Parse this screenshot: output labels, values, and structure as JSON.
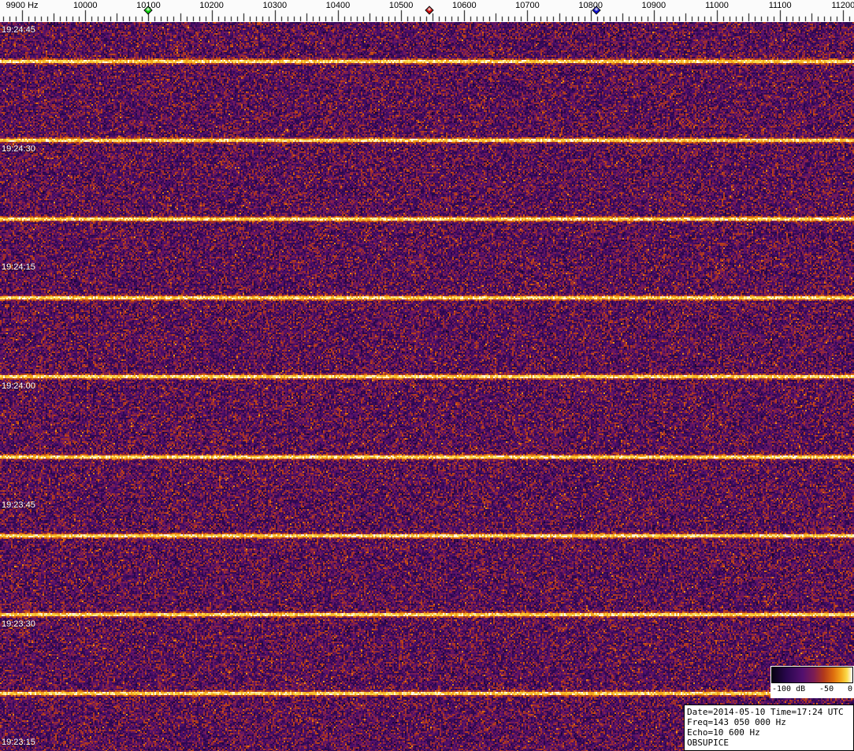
{
  "chart_data": {
    "type": "heatmap",
    "subtype": "radio-spectrogram-waterfall",
    "x_axis": {
      "unit": "Hz",
      "start": 9865,
      "end": 11217,
      "tick_step": 100,
      "minor_tick_step": 10,
      "tick_values": [
        9900,
        10000,
        10100,
        10200,
        10300,
        10400,
        10500,
        10600,
        10700,
        10800,
        10900,
        11000,
        11100,
        11200
      ],
      "tick_labels": [
        "9900 Hz",
        "10000",
        "10100",
        "10200",
        "10300",
        "10400",
        "10500",
        "10600",
        "10700",
        "10800",
        "10900",
        "11000",
        "11100",
        "11200"
      ]
    },
    "y_axis": {
      "unit": "time UTC",
      "direction": "newest-on-top",
      "tick_interval_s": 15,
      "tick_labels": [
        "19:24:45",
        "19:24:30",
        "19:24:15",
        "19:24:00",
        "19:23:45",
        "19:23:30",
        "19:23:15"
      ]
    },
    "markers": [
      {
        "name": "green-marker",
        "color": "#00cc00",
        "freq_hz": 10100
      },
      {
        "name": "red-marker",
        "color": "#cc0000",
        "freq_hz": 10545
      },
      {
        "name": "blue-marker",
        "color": "#0000cc",
        "freq_hz": 10810
      }
    ],
    "pulses": {
      "interval_s": 10,
      "count": 9
    },
    "colormap": [
      "#080212",
      "#2a074e",
      "#52106e",
      "#7c1c54",
      "#b0381c",
      "#dd6c0e",
      "#f4a81c",
      "#fbda4a",
      "#ffffff"
    ],
    "colorbar": {
      "min_db": -100,
      "mid_db": -50,
      "max_db": 0,
      "labels": [
        "-100 dB",
        "-50",
        "0"
      ]
    },
    "legend_position": "bottom-right",
    "grid": false
  },
  "info_box": {
    "lines": [
      "Date=2014-05-10 Time=17:24 UTC",
      "Freq=143 050 000 Hz",
      "Echo=10 600 Hz",
      "OBSUPICE"
    ]
  }
}
